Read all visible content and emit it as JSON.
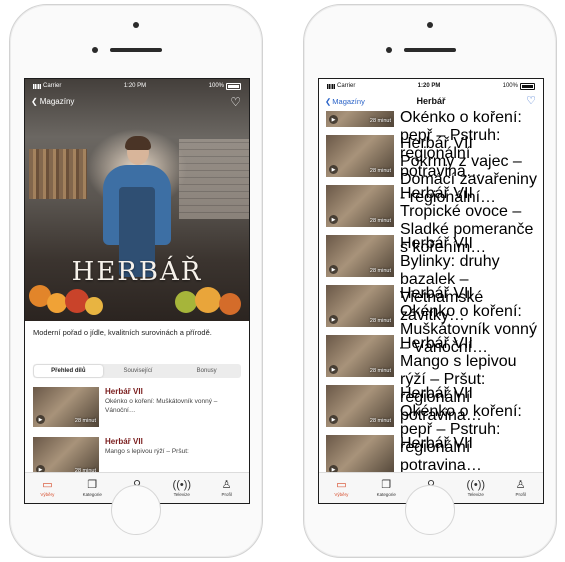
{
  "left": {
    "status": {
      "carrier": "Carrier",
      "time": "1:20 PM",
      "battery": "100%"
    },
    "nav": {
      "back_label": "Magazíny"
    },
    "show_logo": "HERBÁŘ",
    "description": "Moderní pořad o jídle, kvalitních surovinách a přírodě.",
    "segments": [
      {
        "label": "Přehled dílů",
        "active": true
      },
      {
        "label": "Související",
        "active": false
      },
      {
        "label": "Bonusy",
        "active": false
      }
    ],
    "episodes": [
      {
        "title": "Herbář VII",
        "subtitle": "Okénko o koření: Muškátovník vonný – Vánoční…",
        "duration": "28 minut"
      },
      {
        "title": "Herbář VII",
        "subtitle": "Mango s lepivou rýží – Pršut:",
        "duration": "28 minut"
      }
    ]
  },
  "right": {
    "status": {
      "carrier": "Carrier",
      "time": "1:20 PM",
      "battery": "100%"
    },
    "nav": {
      "back_label": "Magazíny",
      "title": "Herbář"
    },
    "top_partial": {
      "subtitle": "Okénko o koření: pepř – Pstruh: regionální potravina…",
      "duration": "28 minut"
    },
    "episodes": [
      {
        "title": "Herbář VII",
        "subtitle": "Pokrmy z vajec – Domácí zavařeniny - regionální…",
        "duration": "28 minut"
      },
      {
        "title": "Herbář VII",
        "subtitle": "Tropické ovoce – Sladké pomeranče s kořením…",
        "duration": "28 minut"
      },
      {
        "title": "Herbář VII",
        "subtitle": "Bylinky: druhy bazalek – Vietnamské závitky…",
        "duration": "28 minut"
      },
      {
        "title": "Herbář VII",
        "subtitle": "Okénko o koření: Muškátovník vonný – Vánoční…",
        "duration": "28 minut"
      },
      {
        "title": "Herbář VII",
        "subtitle": "Mango s lepivou rýží – Pršut: regionální potravina…",
        "duration": "28 minut"
      },
      {
        "title": "Herbář VII",
        "subtitle": "Okénko o koření: pepř – Pstruh: regionální potravina…",
        "duration": "28 minut"
      },
      {
        "title": "Herbář VII",
        "subtitle": "",
        "duration": ""
      }
    ]
  },
  "tabbar": [
    {
      "label": "Výběry",
      "icon": "tv-icon",
      "active": true
    },
    {
      "label": "Kategorie",
      "icon": "categories-icon",
      "active": false
    },
    {
      "label": "Hledat",
      "icon": "search-icon",
      "active": false
    },
    {
      "label": "Televize",
      "icon": "broadcast-icon",
      "active": false
    },
    {
      "label": "Profil",
      "icon": "profile-icon",
      "active": false
    }
  ],
  "colors": {
    "accent": "#d64b2a",
    "title": "#7a1d1d",
    "link": "#2a63c8"
  }
}
